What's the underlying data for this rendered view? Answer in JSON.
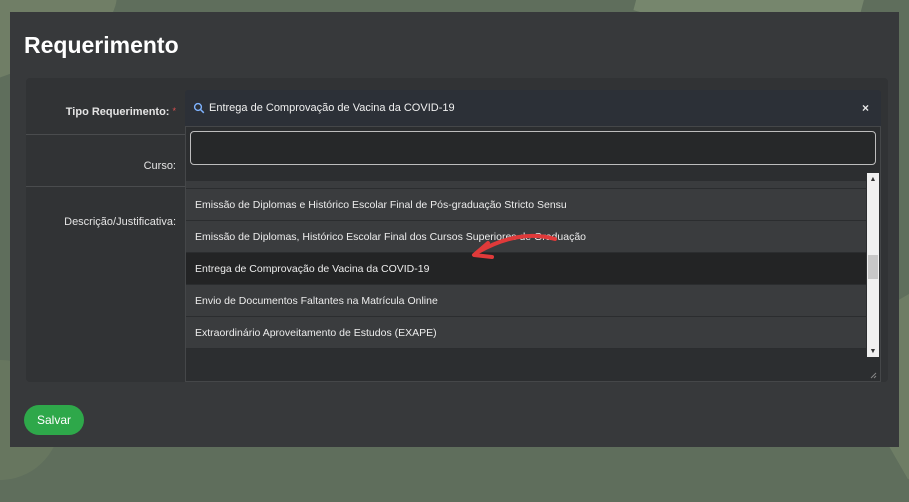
{
  "page": {
    "title": "Requerimento"
  },
  "form": {
    "tipo_label": "Tipo Requerimento:",
    "required_marker": "*",
    "curso_label": "Curso:",
    "descricao_label": "Descrição/Justificativa:",
    "tipo_selected": "Entrega de Comprovação de Vacina da COVID-19",
    "clear_symbol": "×",
    "dropdown_search_value": "",
    "options": [
      {
        "label": ""
      },
      {
        "label": "Emissão de Diplomas e Histórico Escolar Final de Pós-graduação Stricto Sensu"
      },
      {
        "label": "Emissão de Diplomas, Histórico Escolar Final dos Cursos Superiores de Graduação"
      },
      {
        "label": "Entrega de Comprovação de Vacina da COVID-19"
      },
      {
        "label": "Envio de Documentos Faltantes na Matrícula Online"
      },
      {
        "label": "Extraordinário Aproveitamento de Estudos (EXAPE)"
      }
    ],
    "highlighted_index": 3
  },
  "actions": {
    "save_label": "Salvar"
  },
  "colors": {
    "save_button": "#2ea84a",
    "annotation_arrow": "#e03a3a",
    "required": "#e05050"
  },
  "icons": {
    "search": "search-icon",
    "clear": "close-icon",
    "annotation": "red-arrow-annotation"
  }
}
